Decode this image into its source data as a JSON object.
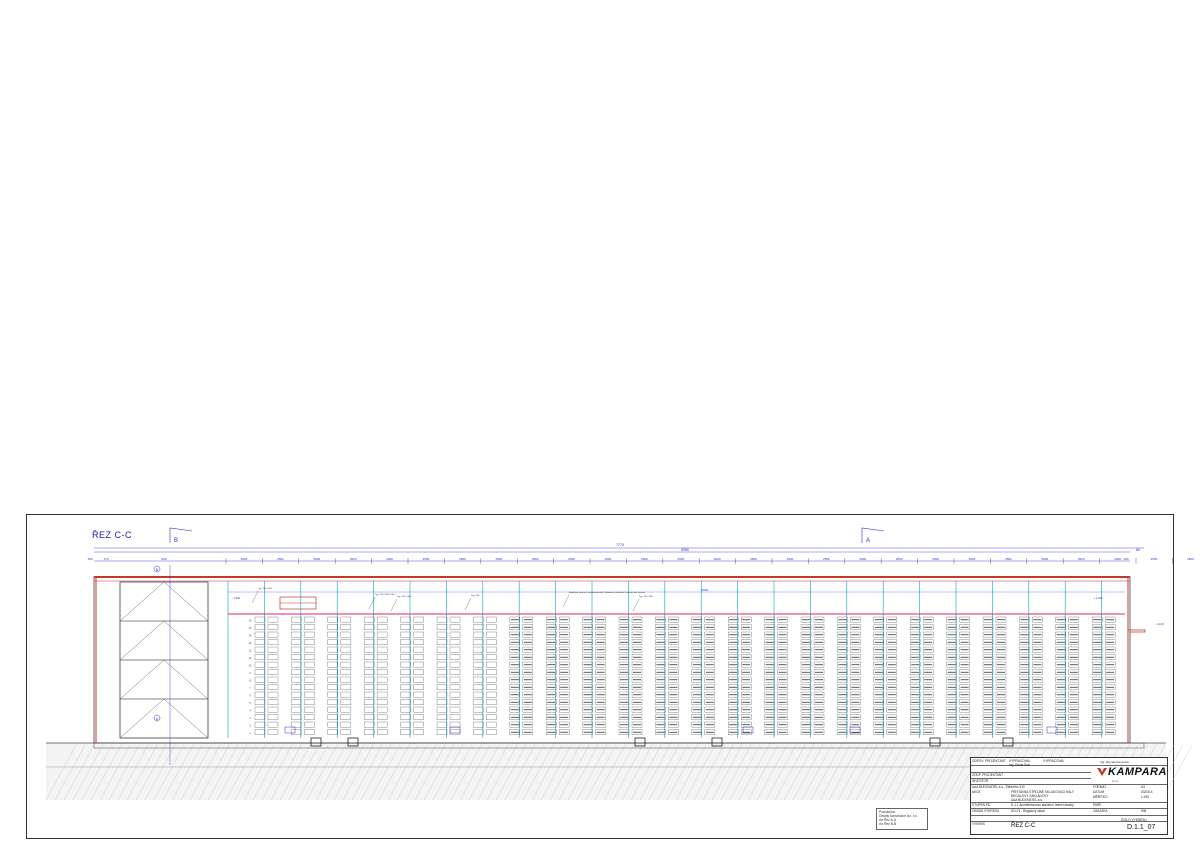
{
  "sheet": {
    "section_title": "ŘEZ C-C",
    "section_marks": [
      "B",
      "A"
    ],
    "overall_dimension": "7775",
    "secondary_dimension": "5350",
    "end_dimension": "80",
    "inner_dimension": "6500",
    "left_dims": [
      "180",
      "170",
      "600"
    ],
    "bay_dimension": "2500",
    "bay_count": 28,
    "right_dim": "180",
    "grid_label": "B",
    "grid_label_bottom": "A",
    "level_marks": [
      "1.120",
      "- 1.000",
      "+ 1.000"
    ],
    "rack_levels": [
      "16",
      "15",
      "14",
      "13",
      "12",
      "11",
      "10",
      "9",
      "8",
      "7",
      "6",
      "5",
      "4",
      "3",
      "2",
      "1"
    ],
    "callouts": [
      "Typ. 200 / 500",
      "Typ. 200 / 500 / 540",
      "Typ. 200 / 300",
      "Typ. 200",
      "Regálový systém / automatizovaný / skladovací jednotky / rozměry dle výrobce",
      "Typ. 200 / 300"
    ]
  },
  "notes": {
    "heading": "Poznámka:",
    "lines": [
      "Detaily konstrukce viz. č.v.",
      "viz Řez A-A",
      "viz Řez B-B"
    ]
  },
  "title_block": {
    "hlavni_projektant_label": "ODPOV. PROJEKTANT",
    "hlavni_projektant": "Ing. Pavel Šulc",
    "vypracoval_label": "VYPRACOVAL",
    "zodp_label": "ZODP. PROJEKTANT",
    "investor_label": "INVESTOR",
    "investor": "AAA BUDOVATEL a.s., Štědrého 310",
    "akce_label": "AKCE",
    "akce_lines": [
      "PŘÍSTAVBA STROJNĚ SKLADOVACÍ HALY",
      "REGÁLOVÝ ZÁKLADOVÝ",
      "AAA BUDOVATEL a.s."
    ],
    "stupen_label": "STUPEŇ PD",
    "stupen": "D.1.1 Architektonicko stavební řešení stavby",
    "obsah_label": "OBSAH VÝKRESU",
    "obsah": "SO-01 - Regálový sklad",
    "vykres_label": "VÝKRES",
    "vykres": "ŘEZ C-C",
    "format_label": "FORMÁT",
    "format": "A3",
    "datum_label": "DATUM",
    "datum": "03/2014",
    "meritko_label": "MĚŘÍTKO",
    "meritko": "1:150",
    "paré_label": "PARÉ",
    "zakazka_label": "ZAKÁZKA",
    "zakazka": "008",
    "cislo_label": "ČÍSLO VÝKRESU",
    "cislo": "D.1.1_07",
    "logo_text": "KAMPARA",
    "logo_sub": "Ing. Zbyněk Kampara",
    "logo_sub2": "s.r.o."
  },
  "colors": {
    "line": "#444444",
    "dimension": "#2a2ad4",
    "roof": "#c0392b",
    "steel": "#00a3c4",
    "highlight": "#e0207a",
    "ground": "#888888"
  }
}
